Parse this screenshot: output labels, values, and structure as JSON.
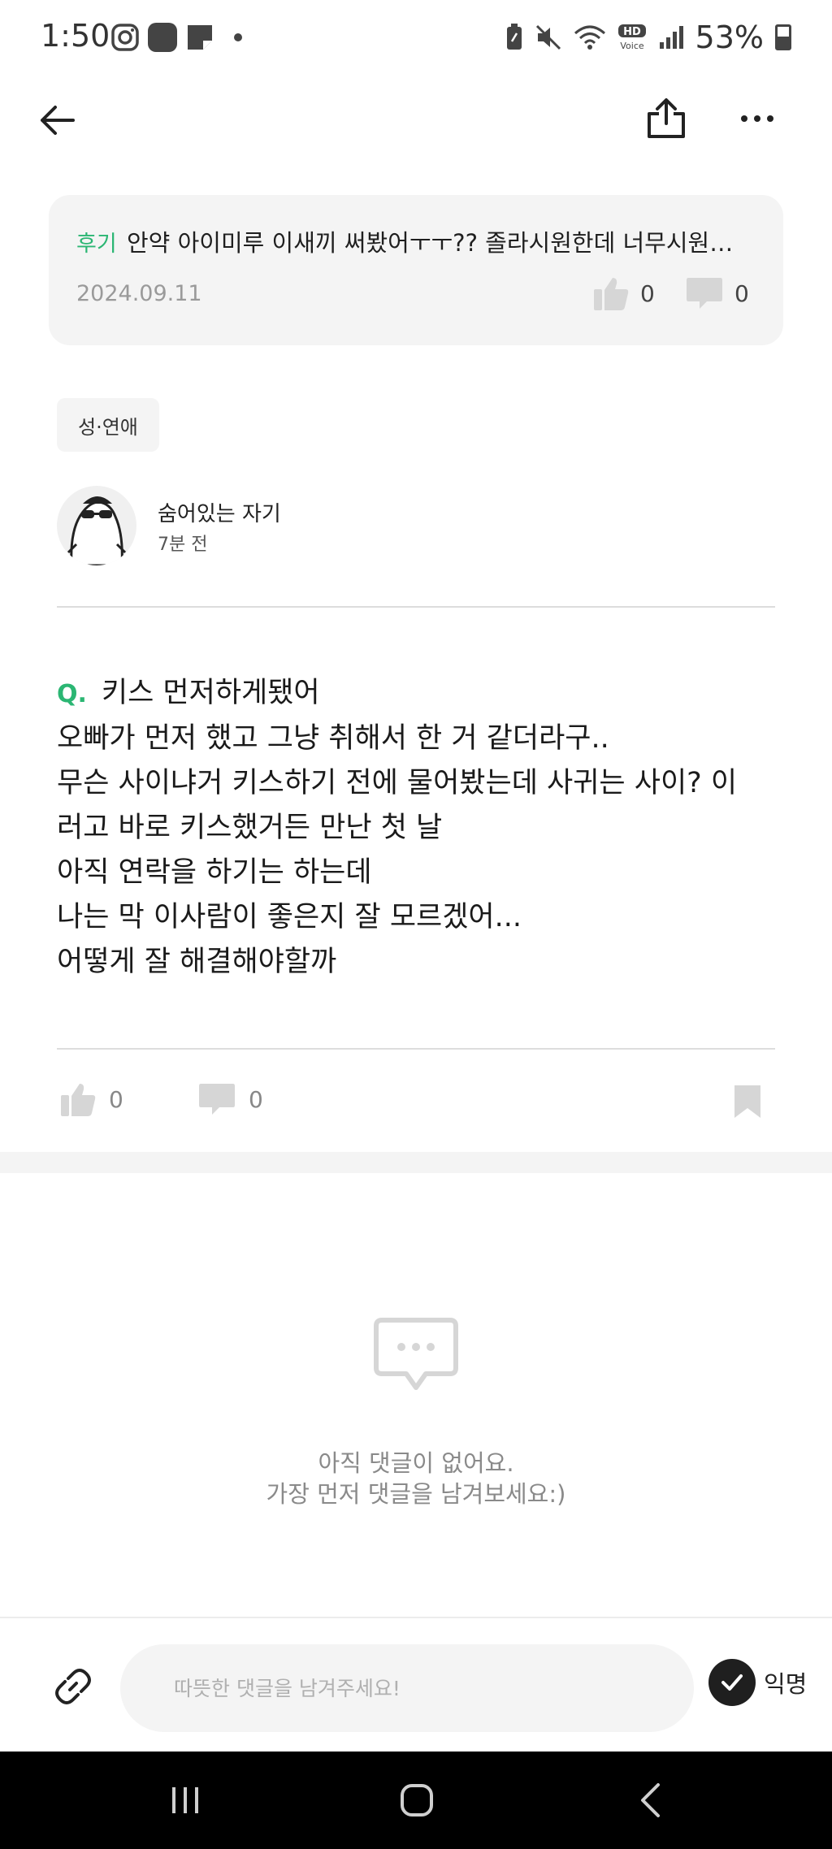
{
  "status_bar": {
    "time": "1:50",
    "battery_percent": "53%",
    "icons": [
      "instagram-icon",
      "app-icon",
      "notes-icon",
      "dot-icon",
      "battery-saver-icon",
      "mute-icon",
      "wifi-icon",
      "hd-voice-icon",
      "signal-icon",
      "battery-icon"
    ]
  },
  "app_bar": {
    "icons": [
      "back-arrow-icon",
      "share-icon",
      "more-icon"
    ]
  },
  "review_card": {
    "tag": "후기",
    "title": "안약 아이미루 이새끼 써봤어ㅜㅜ?? 졸라시원한데 너무시원…",
    "date": "2024.09.11",
    "likes": "0",
    "comments": "0"
  },
  "category": "성·연애",
  "author": {
    "name": "숨어있는 자기",
    "time": "7분 전"
  },
  "post": {
    "q_label": "Q.",
    "lines": [
      "키스 먼저하게됐어",
      "오빠가 먼저 했고 그냥 취해서 한 거 같더라구..",
      "무슨 사이냐거 키스하기 전에 물어봤는데 사귀는 사이? 이",
      "러고 바로 키스했거든 만난 첫 날",
      "아직 연락을 하기는 하는데",
      "나는 막 이사람이 좋은지 잘 모르겠어...",
      "어떻게 잘 해결해야할까"
    ]
  },
  "reactions": {
    "likes": "0",
    "comments": "0"
  },
  "empty_comments": {
    "line1": "아직 댓글이 없어요.",
    "line2": "가장 먼저 댓글을 남겨보세요:)"
  },
  "comment_input": {
    "placeholder": "따뜻한 댓글을 남겨주세요!",
    "anonymous_label": "익명"
  },
  "colors": {
    "accent_green": "#2bb673",
    "card_bg": "#f4f4f4",
    "icon_gray": "#d6d6d6"
  }
}
